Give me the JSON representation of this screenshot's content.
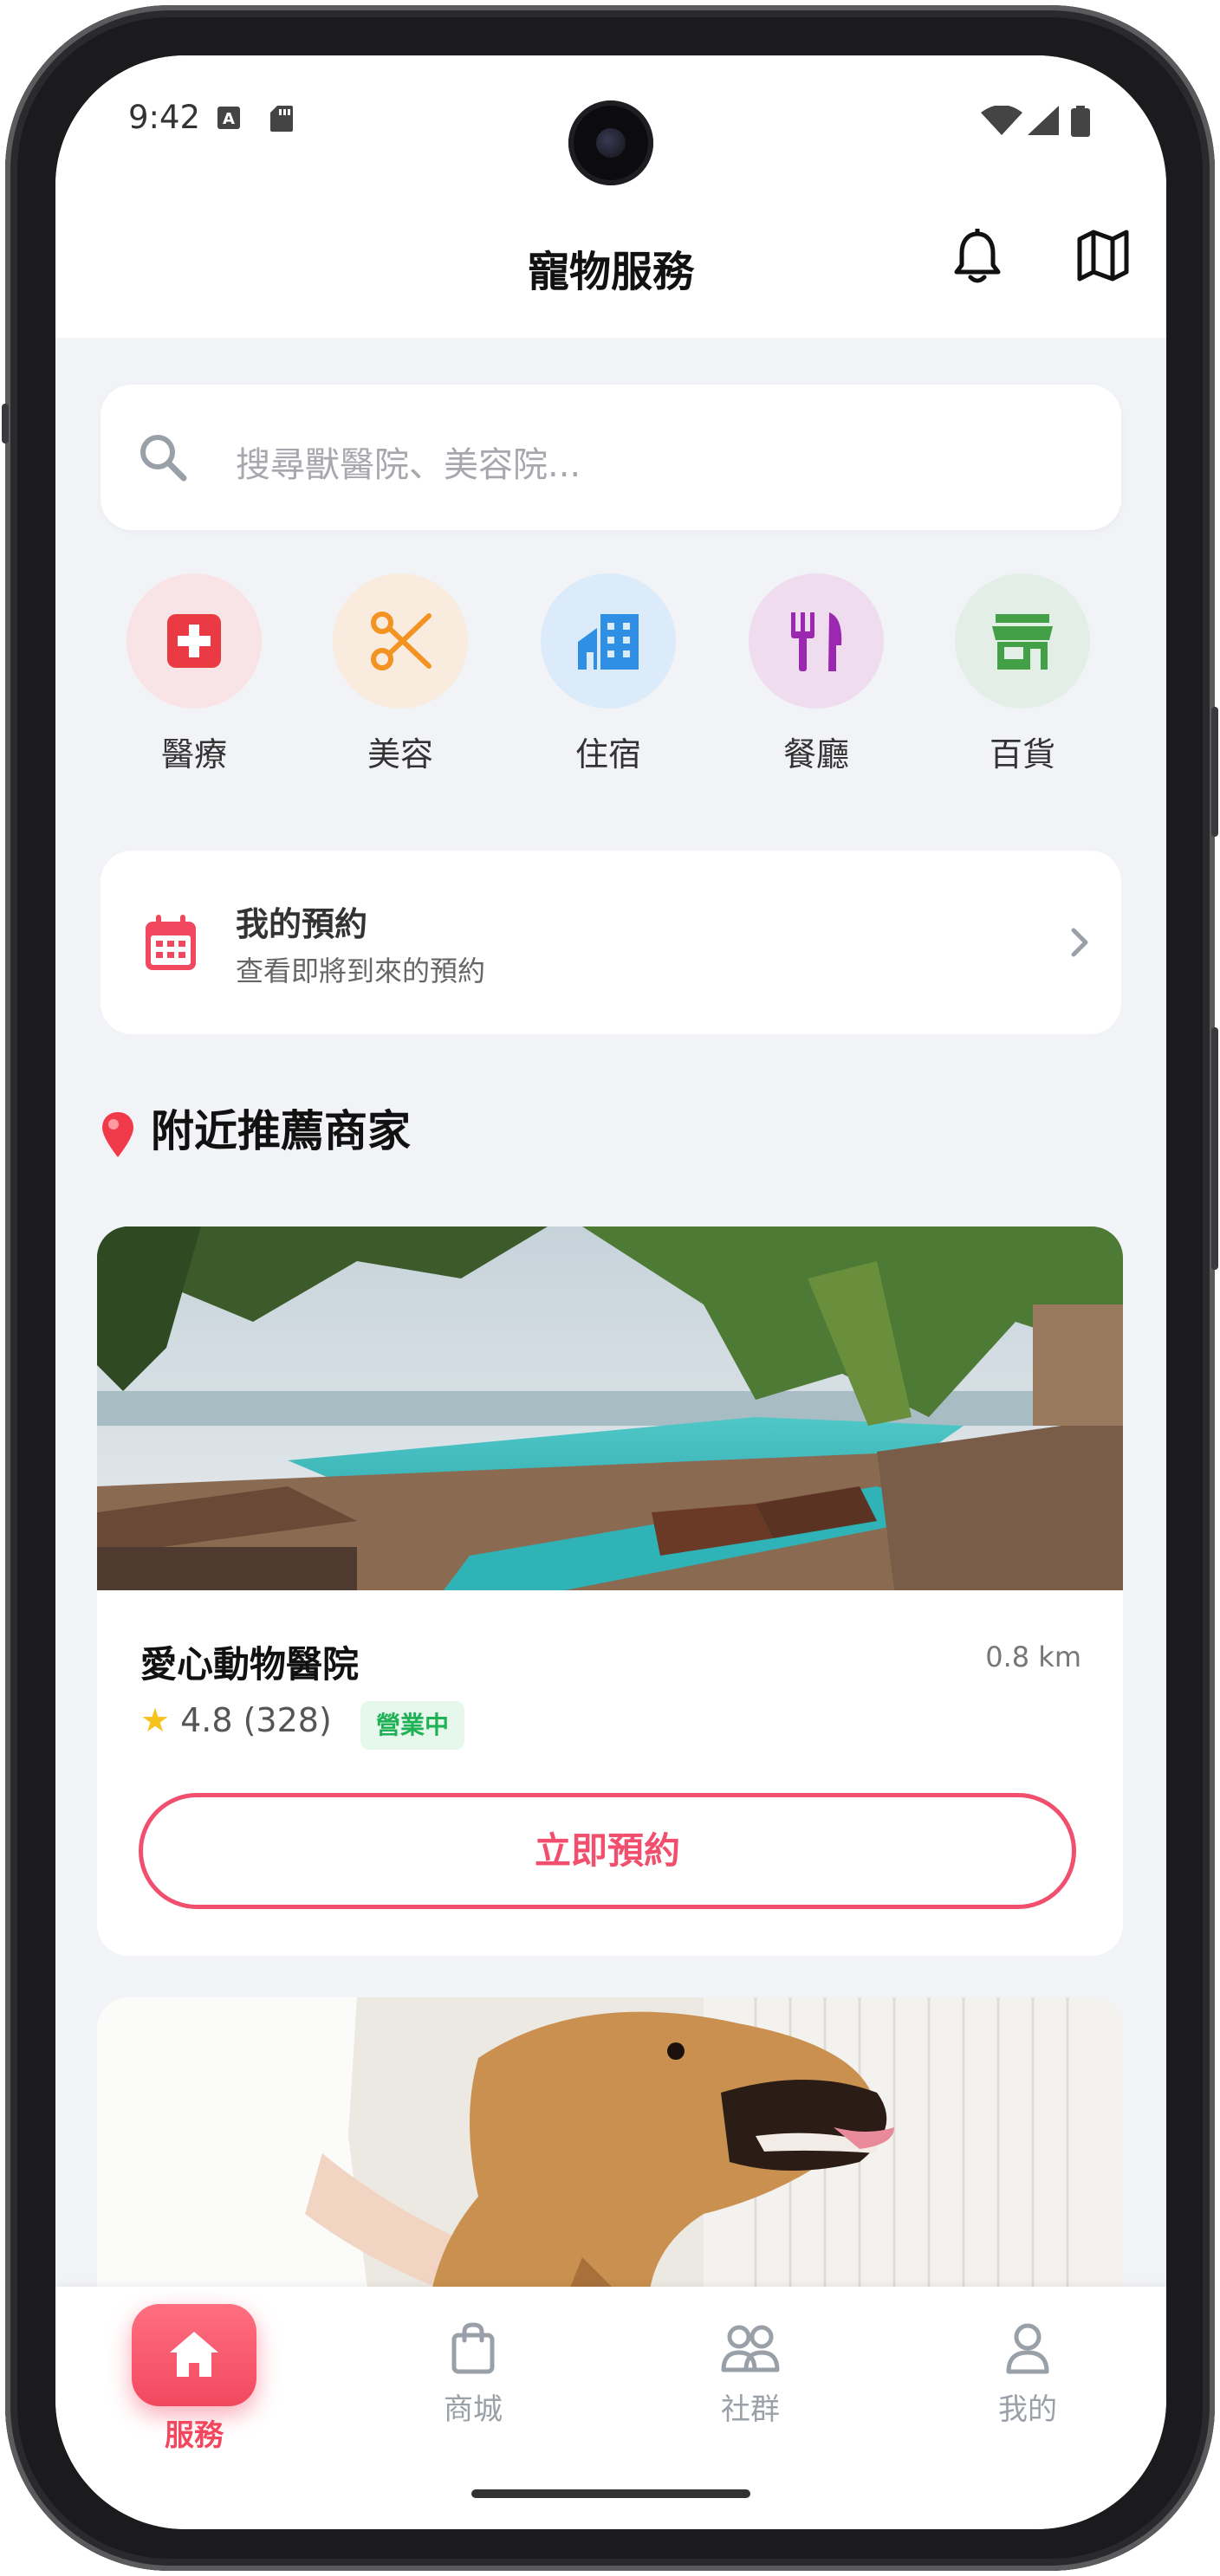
{
  "status_bar": {
    "time": "9:42"
  },
  "header": {
    "title": "寵物服務"
  },
  "search": {
    "placeholder": "搜尋獸醫院、美容院..."
  },
  "categories": [
    {
      "label": "醫療",
      "icon": "medical-cross-icon",
      "bg": "#f8e3e6",
      "color": "#ea3b45"
    },
    {
      "label": "美容",
      "icon": "scissors-icon",
      "bg": "#f9ebde",
      "color": "#f29322"
    },
    {
      "label": "住宿",
      "icon": "building-icon",
      "bg": "#dcebf9",
      "color": "#2f8fe5"
    },
    {
      "label": "餐廳",
      "icon": "fork-knife-icon",
      "bg": "#efdcef",
      "color": "#9c27b0"
    },
    {
      "label": "百貨",
      "icon": "store-icon",
      "bg": "#e3efe6",
      "color": "#43a047"
    }
  ],
  "appointments": {
    "title": "我的預約",
    "subtitle": "查看即將到來的預約"
  },
  "section": {
    "title": "附近推薦商家"
  },
  "merchants": [
    {
      "name": "愛心動物醫院",
      "distance": "0.8 km",
      "rating": "4.8 (328)",
      "status": "營業中",
      "action": "立即預約"
    }
  ],
  "bottom_nav": [
    {
      "label": "服務",
      "icon": "home-icon",
      "active": true
    },
    {
      "label": "商城",
      "icon": "shopping-bag-icon",
      "active": false
    },
    {
      "label": "社群",
      "icon": "people-icon",
      "active": false
    },
    {
      "label": "我的",
      "icon": "person-icon",
      "active": false
    }
  ],
  "colors": {
    "accent": "#f2485f",
    "open_badge": "#1fb155",
    "background": "#f2f3f7"
  }
}
